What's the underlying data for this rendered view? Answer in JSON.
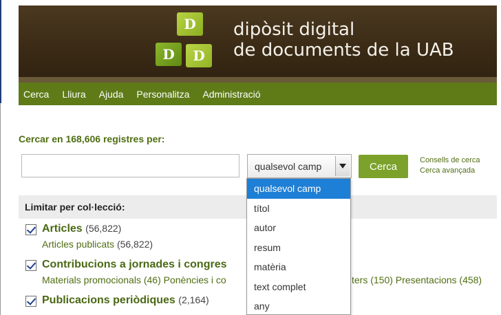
{
  "brand": {
    "line1": "dipòsit digital",
    "line2": "de documents de la UAB",
    "cube_letter": "D"
  },
  "nav": {
    "items": [
      "Cerca",
      "Lliura",
      "Ajuda",
      "Personalitza",
      "Administració"
    ]
  },
  "search": {
    "heading": "Cercar en 168,606 registres per:",
    "query_value": "",
    "field_selected": "qualsevol camp",
    "button_label": "Cerca",
    "tips_link": "Consells de cerca",
    "advanced_link": "Cerca avançada"
  },
  "dropdown": {
    "options": [
      "qualsevol camp",
      "títol",
      "autor",
      "resum",
      "matèria",
      "text complet",
      "any"
    ],
    "selected_index": 0
  },
  "limit": {
    "heading": "Limitar per col·lecció:",
    "collections": [
      {
        "title": "Articles",
        "count": "(56,822)",
        "sub_text": "Articles publicats",
        "sub_count": "(56,822)",
        "checked": true
      },
      {
        "title": "Contribucions a jornades i congres",
        "count": "",
        "sub_text": "Materials promocionals (46) Ponències i co",
        "sub_tail": "ters (150) Presentacions (458)",
        "checked": true
      },
      {
        "title": "Publicacions periòdiques",
        "count": "(2,164)",
        "checked": true
      }
    ]
  },
  "colors": {
    "nav_bg": "#5e7b18",
    "accent_green": "#4f6d12",
    "button_bg": "#7ca22b",
    "dropdown_highlight": "#1e7fd6",
    "banner_bg": "#3b2b16"
  }
}
